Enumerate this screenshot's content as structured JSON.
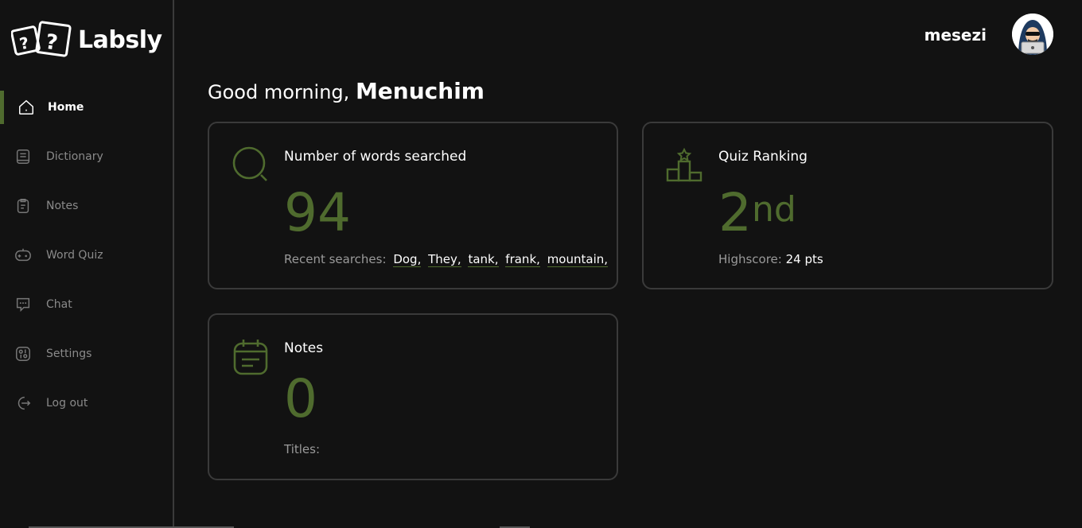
{
  "app": {
    "name": "Labsly"
  },
  "user": {
    "username": "mesezi",
    "greeting": "Good morning,",
    "name": "Menuchim"
  },
  "sidebar": {
    "items": [
      {
        "label": "Home",
        "icon": "home-icon"
      },
      {
        "label": "Dictionary",
        "icon": "book-icon"
      },
      {
        "label": "Notes",
        "icon": "clipboard-icon"
      },
      {
        "label": "Word Quiz",
        "icon": "gamepad-icon"
      },
      {
        "label": "Chat",
        "icon": "chat-icon"
      },
      {
        "label": "Settings",
        "icon": "settings-icon"
      },
      {
        "label": "Log out",
        "icon": "logout-icon"
      }
    ]
  },
  "cards": {
    "words": {
      "title": "Number of words searched",
      "value": "94",
      "footer_label": "Recent searches:",
      "recent": [
        "Dog,",
        "They,",
        "tank,",
        "frank,",
        "mountain,"
      ]
    },
    "quiz": {
      "title": "Quiz Ranking",
      "rank": "2",
      "rank_suffix": "nd",
      "footer_label": "Highscore:",
      "highscore": "24 pts"
    },
    "notes": {
      "title": "Notes",
      "value": "0",
      "footer_label": "Titles:"
    }
  },
  "colors": {
    "accent": "#4f6b2e",
    "background": "#121212",
    "border": "#3a3a3a"
  }
}
